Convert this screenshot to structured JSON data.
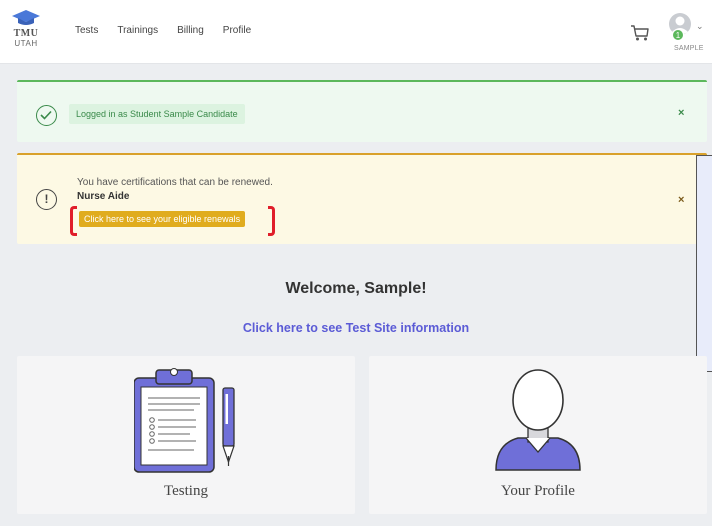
{
  "header": {
    "logo": {
      "line1": "TMU",
      "line2": "UTAH"
    },
    "nav": [
      {
        "label": "Tests"
      },
      {
        "label": "Trainings"
      },
      {
        "label": "Billing"
      },
      {
        "label": "Profile"
      }
    ],
    "cart_icon": "cart-icon",
    "user": {
      "badge_count": "1",
      "label": "SAMPLE",
      "icon": "user-avatar-icon"
    }
  },
  "alerts": {
    "success": {
      "text": "Logged in as Student Sample Candidate",
      "icon": "check-circle-icon",
      "close": "×",
      "color": "#5cb85c"
    },
    "warning": {
      "line1": "You have certifications that can be renewed.",
      "line2": "Nurse Aide",
      "button": "Click here to see your eligible renewals",
      "icon": "exclamation-circle-icon",
      "close": "×",
      "color": "#d9a12b"
    }
  },
  "welcome": {
    "title": "Welcome, Sample!",
    "link": "Click here to see Test Site information"
  },
  "cards": [
    {
      "label": "Testing",
      "icon": "clipboard-icon"
    },
    {
      "label": "Your Profile",
      "icon": "profile-person-icon"
    }
  ],
  "colors": {
    "accent": "#5b5bd6",
    "success": "#5cb85c",
    "warning": "#e0ac1e",
    "highlight": "#e01e2a"
  }
}
